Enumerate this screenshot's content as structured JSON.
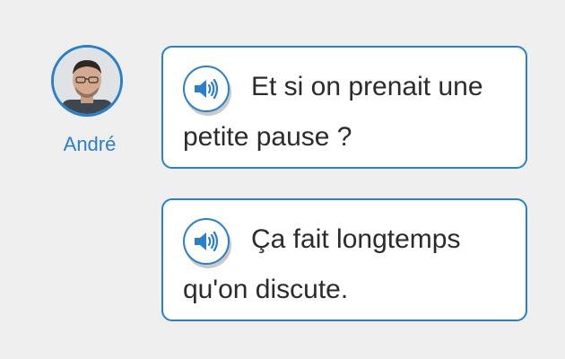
{
  "speaker": {
    "name": "André"
  },
  "messages": [
    {
      "line1": "Et si on prenait une",
      "line2": "petite pause ?"
    },
    {
      "line1": "Ça fait longtemps",
      "line2": "qu'on discute."
    }
  ],
  "colors": {
    "accent": "#2a7fc9",
    "background": "#efefef",
    "bubble": "#ffffff",
    "text": "#2b2b2b"
  },
  "icons": {
    "audio": "speaker-icon"
  }
}
